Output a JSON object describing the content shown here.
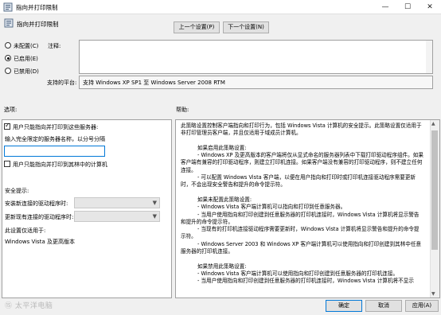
{
  "window": {
    "title": "指向并打印限制",
    "controls": {
      "minimize": "—",
      "maximize": "☐",
      "close": "✕"
    }
  },
  "header": {
    "policy_title": "指向并打印限制",
    "prev_button": "上一个设置(P)",
    "next_button": "下一个设置(N)"
  },
  "state": {
    "options": [
      "未配置(C)",
      "已启用(E)",
      "已禁用(D)"
    ],
    "selected_index": 1
  },
  "comment": {
    "label": "注释:",
    "value": ""
  },
  "supported": {
    "label": "支持的平台:",
    "value": "支持 Windows XP SP1 至 Windows Server 2008 RTM"
  },
  "sections": {
    "options": "选项:",
    "help": "帮助:"
  },
  "options": {
    "only_trusted_servers": {
      "label": "用户只能指向并打印到这些服务器:",
      "checked": true
    },
    "server_names_label": "输入完全限定的服务器名称，以分号分隔",
    "server_names_value": "",
    "only_forest_servers": {
      "label": "用户只能指向并打印到其林中的计算机",
      "checked": false
    },
    "security_prompt_label": "安全提示:",
    "new_connection_label": "安装新连接的驱动程序时:",
    "new_connection_value": "",
    "update_label": "更新现有连接的驱动程序时:",
    "update_value": "",
    "applies_label": "此设置仅适用于:",
    "applies_value": "Windows Vista 及更高版本"
  },
  "help": {
    "text": "此策略设置控制客户端指向和打印行为，包括 Windows Vista 计算机的安全提示。此策略设置仅适用于非打印管理员客户端，并且仅适用于域成员计算机。\n\n          如果启用此策略设置:\n          - Windows XP 及更高版本的客户端将仅从显式命名的服务器列表中下载打印驱动程序组件。如果客户端有兼容的打印驱动程序，则建立打印机连接。如果客户端没有兼容的打印驱动程序，则不建立任何连接。\n          - 可以配置 Windows Vista 客户端，以便在用户指向和打印时或打印机连接驱动程序需要更新时，不会出现安全警告和提升的命令提示符。\n\n          如果未配置此策略设置:\n          - Windows Vista 客户端计算机可以指向和打印到任意服务器。\n          - 当用户使用指向和打印创建到任意服务器的打印机连接时，Windows Vista 计算机将显示警告和提升的命令提示符。\n          - 当现有的打印机连接驱动程序需要更新时，Windows Vista 计算机将显示警告和提升的命令提示符。\n          - Windows Server 2003 和 Windows XP 客户端计算机可以使用指向和打印创建到其林中任意服务器的打印机连接。\n\n          如果禁用此策略设置:\n          - Windows Vista 客户端计算机可以使用指向和打印创建到任意服务器的打印机连接。\n          - 当用户使用指向和打印创建到任意服务器的打印机连接时，Windows Vista 计算机将不显示"
  },
  "footer": {
    "ok": "确定",
    "cancel": "取消",
    "apply": "应用(A)"
  },
  "watermark": "⑮ 太平洋电脑"
}
